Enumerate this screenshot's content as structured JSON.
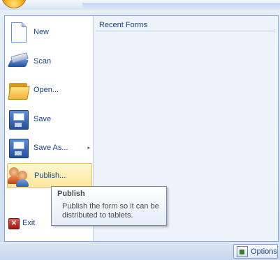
{
  "recent": {
    "title": "Recent Forms"
  },
  "menu": {
    "items": [
      {
        "label": "New",
        "icon": "new-document-icon"
      },
      {
        "label": "Scan",
        "icon": "scanner-icon"
      },
      {
        "label": "Open...",
        "icon": "folder-icon"
      },
      {
        "label": "Save",
        "icon": "floppy-disk-icon"
      },
      {
        "label": "Save As...",
        "icon": "floppy-disk-icon",
        "submenu_arrow": "▸"
      },
      {
        "label": "Publish...",
        "icon": "users-icon"
      }
    ],
    "exit": {
      "label": "Exit",
      "icon_glyph": "✕"
    }
  },
  "tooltip": {
    "title": "Publish",
    "body": "Publish the form so it can be distributed to tablets."
  },
  "footer": {
    "options_label": "Options"
  },
  "colors": {
    "text": "#15428b",
    "hover_bg": "#fde79a",
    "pane_bg": "#eef3fa",
    "exit_red": "#c0281a"
  }
}
